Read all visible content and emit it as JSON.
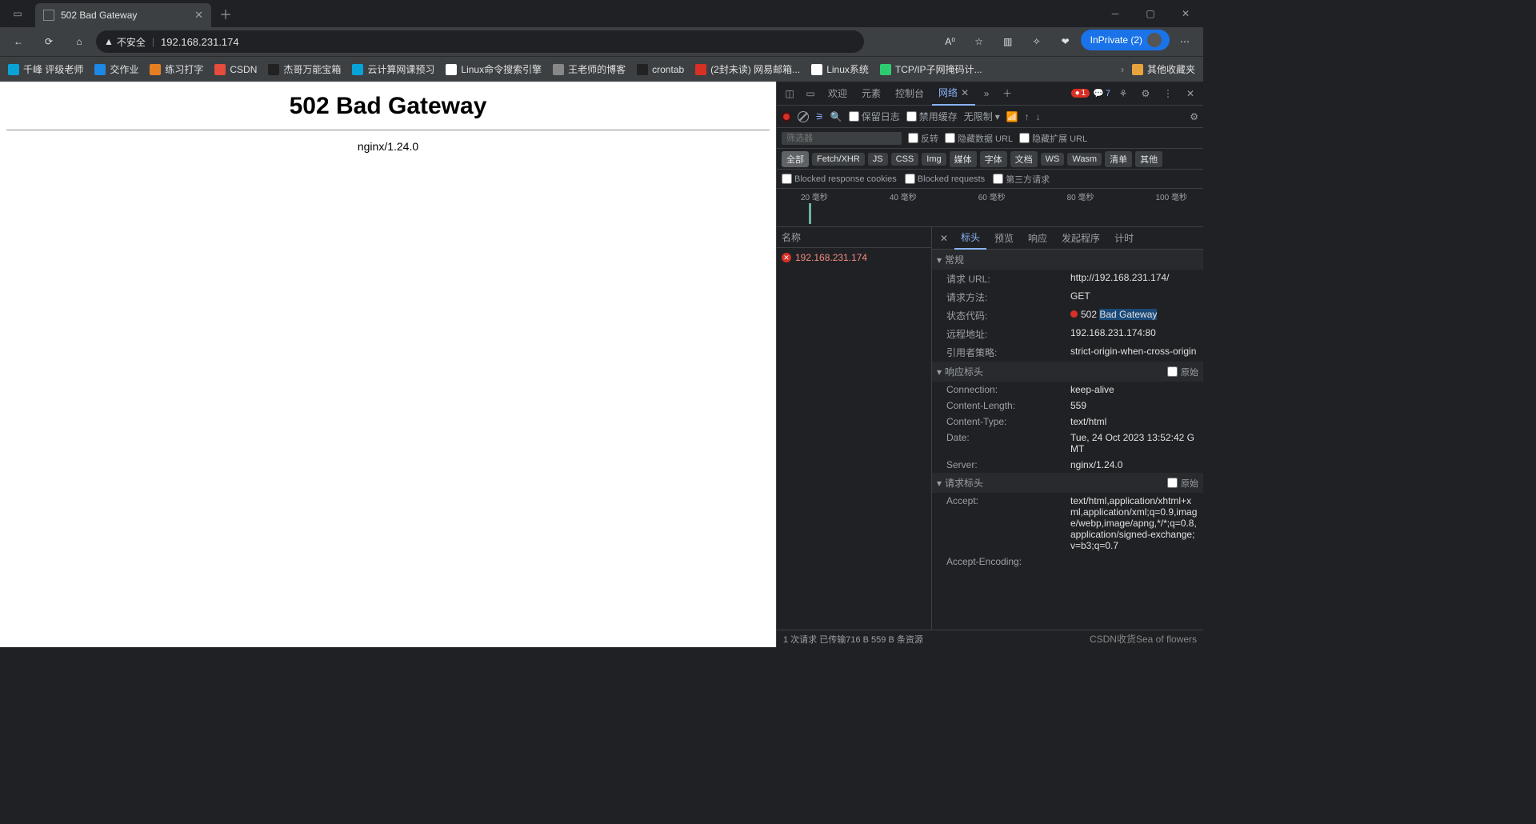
{
  "browser": {
    "tab_title": "502 Bad Gateway",
    "url_security": "不安全",
    "url": "192.168.231.174",
    "inprivate_label": "InPrivate (2)"
  },
  "bookmarks": [
    {
      "label": "千峰 评级老师",
      "color": "#0aa3d8"
    },
    {
      "label": "交作业",
      "color": "#1e88e5"
    },
    {
      "label": "练习打字",
      "color": "#e67e22"
    },
    {
      "label": "CSDN",
      "color": "#e74c3c"
    },
    {
      "label": "杰哥万能宝箱",
      "color": "#222"
    },
    {
      "label": "云计算网课预习",
      "color": "#0aa3d8"
    },
    {
      "label": "Linux命令搜索引擎",
      "color": "#fff"
    },
    {
      "label": "王老师的博客",
      "color": "#888"
    },
    {
      "label": "crontab",
      "color": "#222"
    },
    {
      "label": "(2封未读) 网易邮箱...",
      "color": "#d93025"
    },
    {
      "label": "Linux系统",
      "color": "#fff"
    },
    {
      "label": "TCP/IP子网掩码计...",
      "color": "#2ecc71"
    }
  ],
  "bookmarks_other": "其他收藏夹",
  "page": {
    "heading": "502 Bad Gateway",
    "server": "nginx/1.24.0"
  },
  "devtools": {
    "tabs": {
      "welcome": "欢迎",
      "elements": "元素",
      "console": "控制台",
      "network": "网络"
    },
    "error_count": "1",
    "info_count": "7",
    "toolbar": {
      "preserve_log": "保留日志",
      "disable_cache": "禁用缓存",
      "throttling": "无限制"
    },
    "filter_placeholder": "筛选器",
    "filter_row": {
      "invert": "反转",
      "hide_data": "隐藏数据 URL",
      "hide_ext": "隐藏扩展 URL"
    },
    "types": [
      "全部",
      "Fetch/XHR",
      "JS",
      "CSS",
      "Img",
      "媒体",
      "字体",
      "文档",
      "WS",
      "Wasm",
      "清单",
      "其他"
    ],
    "blocked": {
      "cookies": "Blocked response cookies",
      "requests": "Blocked requests",
      "third": "第三方请求"
    },
    "timeline_ticks": [
      "20 毫秒",
      "40 毫秒",
      "60 毫秒",
      "80 毫秒",
      "100 毫秒"
    ],
    "name_header": "名称",
    "request_name": "192.168.231.174",
    "detail_tabs": {
      "headers": "标头",
      "preview": "预览",
      "response": "响应",
      "initiator": "发起程序",
      "timing": "计时"
    },
    "sections": {
      "general": "常规",
      "response_headers": "响应标头",
      "request_headers": "请求标头",
      "raw": "原始"
    },
    "general": [
      {
        "k": "请求 URL:",
        "v": "http://192.168.231.174/"
      },
      {
        "k": "请求方法:",
        "v": "GET"
      },
      {
        "k": "状态代码:",
        "v": "502 Bad Gateway",
        "status": true
      },
      {
        "k": "远程地址:",
        "v": "192.168.231.174:80"
      },
      {
        "k": "引用者策略:",
        "v": "strict-origin-when-cross-origin"
      }
    ],
    "response_headers": [
      {
        "k": "Connection:",
        "v": "keep-alive"
      },
      {
        "k": "Content-Length:",
        "v": "559"
      },
      {
        "k": "Content-Type:",
        "v": "text/html"
      },
      {
        "k": "Date:",
        "v": "Tue, 24 Oct 2023 13:52:42 GMT"
      },
      {
        "k": "Server:",
        "v": "nginx/1.24.0"
      }
    ],
    "request_headers": [
      {
        "k": "Accept:",
        "v": "text/html,application/xhtml+xml,application/xml;q=0.9,image/webp,image/apng,*/*;q=0.8,application/signed-exchange;v=b3;q=0.7"
      },
      {
        "k": "Accept-Encoding:",
        "v": ""
      }
    ],
    "statusbar": "1 次请求  已传输716 B  559 B 条资源",
    "watermark": "CSDN收货Sea of flowers"
  }
}
